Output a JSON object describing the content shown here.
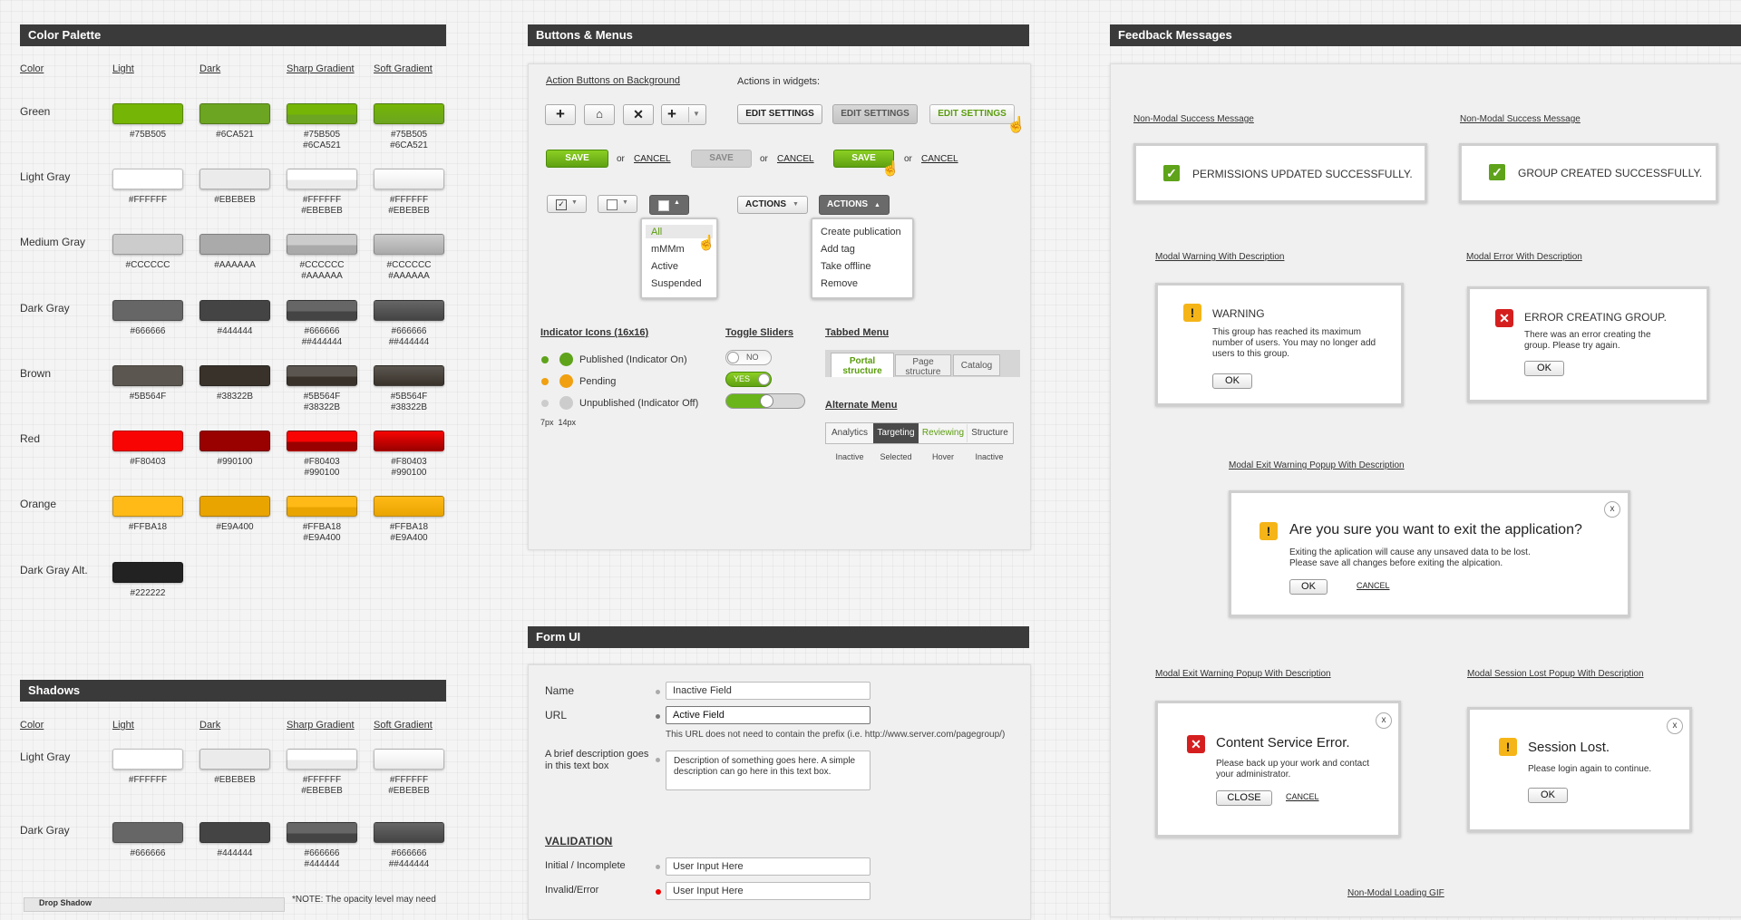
{
  "palette": {
    "title": "Color Palette",
    "col_headers": [
      "Color",
      "Light",
      "Dark",
      "Sharp Gradient",
      "Soft Gradient"
    ],
    "rows": [
      {
        "name": "Green",
        "hex": [
          "#75B505",
          "#6CA521",
          "#75B505\n#6CA521",
          "#75B505\n#6CA521"
        ],
        "c1": "#75B505",
        "c2": "#6CA521"
      },
      {
        "name": "Light Gray",
        "hex": [
          "#FFFFFF",
          "#EBEBEB",
          "#FFFFFF\n#EBEBEB",
          "#FFFFFF\n#EBEBEB"
        ],
        "c1": "#FFFFFF",
        "c2": "#EBEBEB"
      },
      {
        "name": "Medium Gray",
        "hex": [
          "#CCCCCC",
          "#AAAAAA",
          "#CCCCCC\n#AAAAAA",
          "#CCCCCC\n#AAAAAA"
        ],
        "c1": "#CCCCCC",
        "c2": "#AAAAAA"
      },
      {
        "name": "Dark Gray",
        "hex": [
          "#666666",
          "#444444",
          "#666666\n##444444",
          "#666666\n##444444"
        ],
        "c1": "#666666",
        "c2": "#444444"
      },
      {
        "name": "Brown",
        "hex": [
          "#5B564F",
          "#38322B",
          "#5B564F\n#38322B",
          "#5B564F\n#38322B"
        ],
        "c1": "#5B564F",
        "c2": "#38322B"
      },
      {
        "name": "Red",
        "hex": [
          "#F80403",
          "#990100",
          "#F80403\n#990100",
          "#F80403\n#990100"
        ],
        "c1": "#F80403",
        "c2": "#990100"
      },
      {
        "name": "Orange",
        "hex": [
          "#FFBA18",
          "#E9A400",
          "#FFBA18\n#E9A400",
          "#FFBA18\n#E9A400"
        ],
        "c1": "#FFBA18",
        "c2": "#E9A400"
      },
      {
        "name": "Dark Gray Alt.",
        "hex": [
          "#222222"
        ],
        "c1": "#222222",
        "c2": "#222222"
      }
    ]
  },
  "shadows": {
    "title": "Shadows",
    "col_headers": [
      "Color",
      "Light",
      "Dark",
      "Sharp Gradient",
      "Soft Gradient"
    ],
    "rows": [
      {
        "name": "Light Gray",
        "hex": [
          "#FFFFFF",
          "#EBEBEB",
          "#FFFFFF\n#EBEBEB",
          "#FFFFFF\n#EBEBEB"
        ],
        "c1": "#FFFFFF",
        "c2": "#EBEBEB"
      },
      {
        "name": "Dark Gray",
        "hex": [
          "#666666",
          "#444444",
          "#666666\n#444444",
          "#666666\n##444444"
        ],
        "c1": "#666666",
        "c2": "#444444"
      }
    ],
    "drop_shadow": "Drop Shadow",
    "note": "*NOTE: The opacity level may need"
  },
  "buttons": {
    "title": "Buttons & Menus",
    "action_bg_label": "Action Buttons on Background",
    "widgets_label": "Actions in widgets:",
    "edit_settings": "EDIT SETTINGS",
    "save": "SAVE",
    "or": "or",
    "cancel": "CANCEL",
    "actions": "ACTIONS",
    "filter_menu": [
      "All",
      "mMMm",
      "Active",
      "Suspended"
    ],
    "actions_menu": [
      "Create publication",
      "Add tag",
      "Take offline",
      "Remove"
    ],
    "indicator_title": "Indicator Icons (16x16)",
    "indicators": [
      "Published (Indicator On)",
      "Pending",
      "Unpublished (Indicator Off)"
    ],
    "indicator_sizes": "7px  14px",
    "toggle_title": "Toggle Sliders",
    "toggle_no": "NO",
    "toggle_yes": "YES",
    "tabbed_title": "Tabbed Menu",
    "tabs": [
      "Portal structure",
      "Page structure",
      "Catalog"
    ],
    "alt_title": "Alternate Menu",
    "alt_tabs": [
      "Analytics",
      "Targeting",
      "Reviewing",
      "Structure"
    ],
    "alt_states": [
      "Inactive",
      "Selected",
      "Hover",
      "Inactive"
    ]
  },
  "form": {
    "title": "Form UI",
    "name_label": "Name",
    "name_value": "Inactive Field",
    "url_label": "URL",
    "url_value": "Active Field",
    "url_hint": "This URL does not need to contain the prefix (i.e. http://www.server.com/pagegroup/)",
    "desc_label": "A brief description goes in this text box",
    "desc_value": "Description of something goes here. A simple description can go here in this text box.",
    "validation_title": "VALIDATION",
    "initial_label": "Initial / Incomplete",
    "initial_value": "User Input Here",
    "invalid_label": "Invalid/Error",
    "invalid_value": "User Input Here"
  },
  "feedback": {
    "title": "Feedback Messages",
    "success1_label": "Non-Modal Success Message",
    "success1_text": "PERMISSIONS UPDATED SUCCESSFULLY.",
    "success2_label": "Non-Modal Success Message",
    "success2_text": "GROUP CREATED SUCCESSFULLY.",
    "warn_label": "Modal Warning With Description",
    "warn_title": "WARNING",
    "warn_desc": "This group has reached its maximum number of users. You may no longer add users to this group.",
    "err_label": "Modal Error With Description",
    "err_title": "ERROR CREATING GROUP.",
    "err_desc": "There was an error creating the group. Please try again.",
    "ok": "OK",
    "exit_label": "Modal Exit Warning Popup With Description",
    "exit_title": "Are you sure you want to exit the application?",
    "exit_desc1": "Exiting the aplication will cause any unsaved data to be lost.",
    "exit_desc2": "Please save all changes before exiting the alpication.",
    "cancel": "CANCEL",
    "cs_label": "Modal Exit Warning Popup With Description",
    "cs_title": "Content Service Error.",
    "cs_desc": "Please back up your work and contact your administrator.",
    "close": "CLOSE",
    "sl_label": "Modal Session Lost Popup With Description",
    "sl_title": "Session Lost.",
    "sl_desc": "Please login again to continue.",
    "loading_label": "Non-Modal Loading GIF",
    "x": "x"
  }
}
